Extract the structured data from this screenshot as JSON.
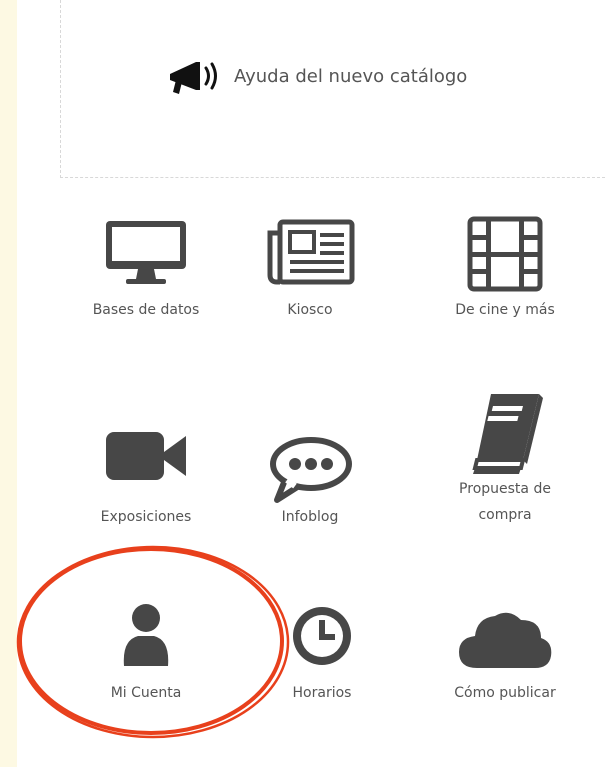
{
  "help": {
    "label": "Ayuda del nuevo catálogo",
    "icon": "megaphone-icon"
  },
  "tiles": [
    {
      "label": "Bases de datos",
      "icon": "monitor-icon"
    },
    {
      "label": "Kiosco",
      "icon": "newspaper-icon"
    },
    {
      "label": "De cine y más",
      "icon": "film-icon"
    },
    {
      "label": "Exposiciones",
      "icon": "video-camera-icon"
    },
    {
      "label": "Infoblog",
      "icon": "speech-bubble-icon"
    },
    {
      "label_line1": "Propuesta de",
      "label_line2": "compra",
      "icon": "book-icon"
    },
    {
      "label": "Mi Cuenta",
      "icon": "user-icon"
    },
    {
      "label": "Horarios",
      "icon": "clock-icon"
    },
    {
      "label": "Cómo publicar",
      "icon": "cloud-icon"
    }
  ],
  "colors": {
    "icon": "#474747",
    "annotation": "#e8401c",
    "text": "#555555",
    "page_background": "#fffdf0"
  }
}
